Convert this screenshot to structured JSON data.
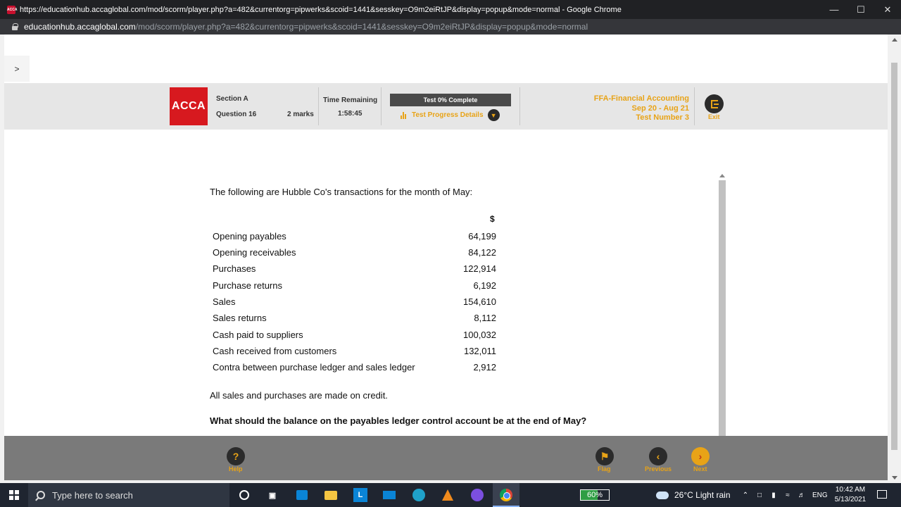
{
  "browser": {
    "title": "https://educationhub.accaglobal.com/mod/scorm/player.php?a=482&currentorg=pipwerks&scoid=1441&sesskey=O9m2eiRtJP&display=popup&mode=normal - Google Chrome",
    "favicon_text": "ACCA",
    "url_domain": "educationhub.accaglobal.com",
    "url_path": "/mod/scorm/player.php?a=482&currentorg=pipwerks&scoid=1441&sesskey=O9m2eiRtJP&display=popup&mode=normal",
    "icons": {
      "minimize": "minimize-icon",
      "maximize": "maximize-icon",
      "close": "close-icon",
      "lock": "lock-icon"
    }
  },
  "sidebar": {
    "toggle_label": ">"
  },
  "header": {
    "logo_text": "ACCA",
    "section": "Section A",
    "question": "Question 16",
    "marks": "2 marks",
    "time_label": "Time Remaining",
    "time_value": "1:58:45",
    "progress_text": "Test 0% Complete",
    "progress_fraction": 0,
    "progress_details_label": "Test Progress Details",
    "course_title": "FFA-Financial Accounting",
    "course_dates": "Sep 20 - Aug 21",
    "test_number": "Test Number 3",
    "exit_label": "Exit"
  },
  "question": {
    "intro": "The following are Hubble Co's transactions for the month of May:",
    "currency_header": "$",
    "rows": [
      {
        "label": "Opening payables",
        "value": "64,199"
      },
      {
        "label": "Opening receivables",
        "value": "84,122"
      },
      {
        "label": "Purchases",
        "value": "122,914"
      },
      {
        "label": "Purchase returns",
        "value": "6,192"
      },
      {
        "label": "Sales",
        "value": "154,610"
      },
      {
        "label": "Sales returns",
        "value": "8,112"
      },
      {
        "label": "Cash paid to suppliers",
        "value": "100,032"
      },
      {
        "label": "Cash received from customers",
        "value": "132,011"
      },
      {
        "label": "Contra between purchase ledger and sales ledger",
        "value": "2,912"
      }
    ],
    "note": "All sales and purchases are made on credit.",
    "prompt": "What should the balance on the payables ledger control account be at the end of May?",
    "answer_prefix": "$",
    "answer_value": ""
  },
  "footer": {
    "help_label": "Help",
    "flag_label": "Flag",
    "previous_label": "Previous",
    "next_label": "Next"
  },
  "taskbar": {
    "search_placeholder": "Type here to search",
    "battery_text": "60%",
    "battery_fraction": 0.6,
    "weather": "26°C  Light rain",
    "language": "ENG",
    "time": "10:42 AM",
    "date": "5/13/2021",
    "l_app_letter": "L"
  },
  "colors": {
    "acca_red": "#d7191f",
    "accent_orange": "#e8a317",
    "header_bg": "#e6e6e6",
    "footer_bg": "#7a7a7a"
  }
}
